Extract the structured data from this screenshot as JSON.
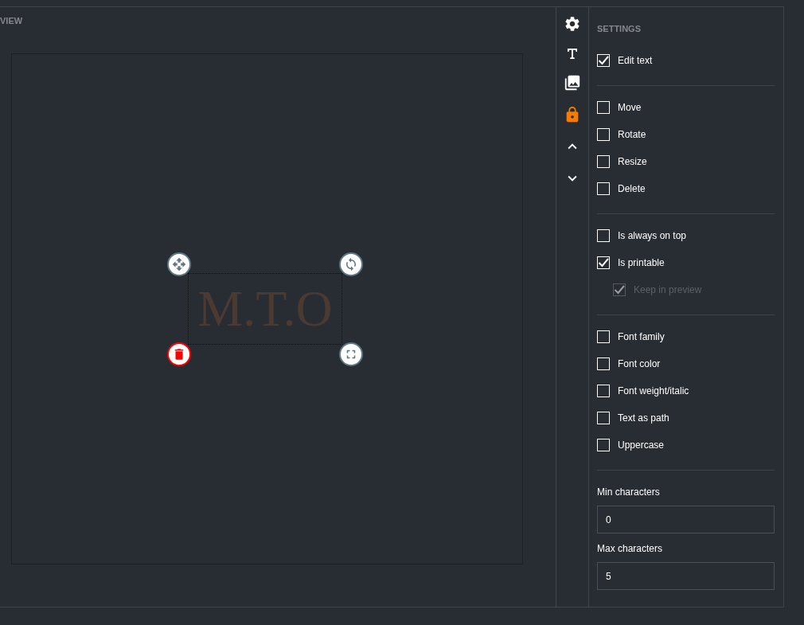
{
  "preview": {
    "title": "VIEW",
    "element": {
      "text": "M.T.O",
      "selected": true
    },
    "handles": [
      {
        "kind": "move"
      },
      {
        "kind": "rotate"
      },
      {
        "kind": "delete"
      },
      {
        "kind": "resize"
      }
    ]
  },
  "toolbar": [
    {
      "kind": "settings",
      "selected": false
    },
    {
      "kind": "text",
      "selected": false
    },
    {
      "kind": "images",
      "selected": false
    },
    {
      "kind": "lock",
      "selected": true
    },
    {
      "kind": "up",
      "selected": false
    },
    {
      "kind": "down",
      "selected": false
    }
  ],
  "settings": {
    "title": "SETTINGS",
    "groups": [
      {
        "items": [
          {
            "label": "Edit text",
            "checked": true,
            "disabled": false
          }
        ]
      },
      {
        "items": [
          {
            "label": "Move",
            "checked": false,
            "disabled": false
          },
          {
            "label": "Rotate",
            "checked": false,
            "disabled": false
          },
          {
            "label": "Resize",
            "checked": false,
            "disabled": false
          },
          {
            "label": "Delete",
            "checked": false,
            "disabled": false
          }
        ]
      },
      {
        "items": [
          {
            "label": "Is always on top",
            "checked": false,
            "disabled": false
          },
          {
            "label": "Is printable",
            "checked": true,
            "disabled": false,
            "children": [
              {
                "label": "Keep in preview",
                "checked": true,
                "disabled": true
              }
            ]
          }
        ]
      },
      {
        "items": [
          {
            "label": "Font family",
            "checked": false,
            "disabled": false
          },
          {
            "label": "Font color",
            "checked": false,
            "disabled": false
          },
          {
            "label": "Font weight/italic",
            "checked": false,
            "disabled": false
          },
          {
            "label": "Text as path",
            "checked": false,
            "disabled": false
          },
          {
            "label": "Uppercase",
            "checked": false,
            "disabled": false
          }
        ]
      }
    ],
    "fields": [
      {
        "label": "Min characters",
        "value": "0"
      },
      {
        "label": "Max characters",
        "value": "5"
      }
    ]
  }
}
